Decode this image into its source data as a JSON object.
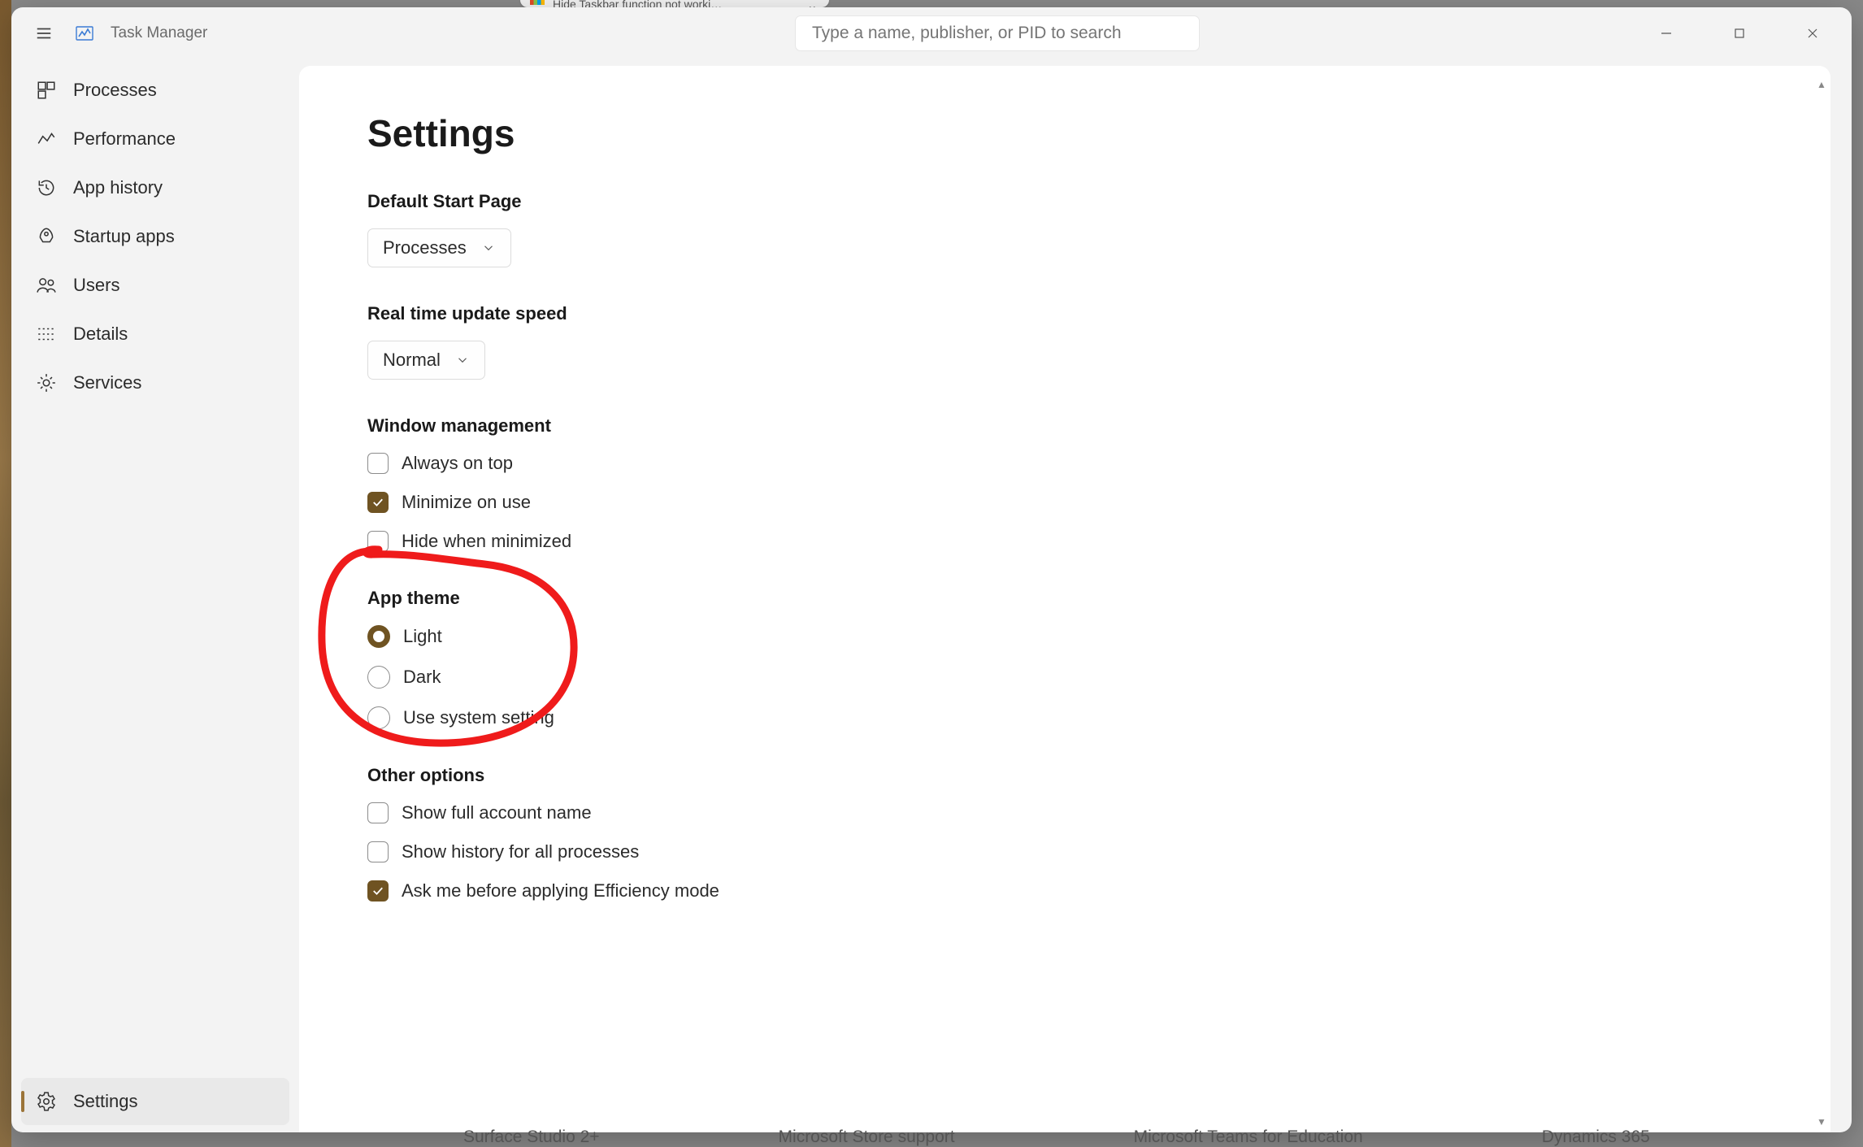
{
  "browser_tab": {
    "title": "Hide Taskbar function not worki…"
  },
  "window": {
    "app_title": "Task Manager",
    "search_placeholder": "Type a name, publisher, or PID to search"
  },
  "sidebar": {
    "items": [
      {
        "label": "Processes"
      },
      {
        "label": "Performance"
      },
      {
        "label": "App history"
      },
      {
        "label": "Startup apps"
      },
      {
        "label": "Users"
      },
      {
        "label": "Details"
      },
      {
        "label": "Services"
      }
    ],
    "bottom_item": {
      "label": "Settings"
    }
  },
  "settings": {
    "page_title": "Settings",
    "default_start_page": {
      "label": "Default Start Page",
      "value": "Processes"
    },
    "update_speed": {
      "label": "Real time update speed",
      "value": "Normal"
    },
    "window_management": {
      "label": "Window management",
      "always_on_top": {
        "label": "Always on top",
        "checked": false
      },
      "minimize_on_use": {
        "label": "Minimize on use",
        "checked": true
      },
      "hide_when_minimized": {
        "label": "Hide when minimized",
        "checked": false
      }
    },
    "app_theme": {
      "label": "App theme",
      "light": {
        "label": "Light",
        "selected": true
      },
      "dark": {
        "label": "Dark",
        "selected": false
      },
      "system": {
        "label": "Use system setting",
        "selected": false
      }
    },
    "other_options": {
      "label": "Other options",
      "show_full_account": {
        "label": "Show full account name",
        "checked": false
      },
      "show_history_all": {
        "label": "Show history for all processes",
        "checked": false
      },
      "efficiency_prompt": {
        "label": "Ask me before applying Efficiency mode",
        "checked": true
      }
    }
  },
  "footer_links": [
    "Surface Studio 2+",
    "Microsoft Store support",
    "Microsoft Teams for Education",
    "Dynamics 365"
  ]
}
